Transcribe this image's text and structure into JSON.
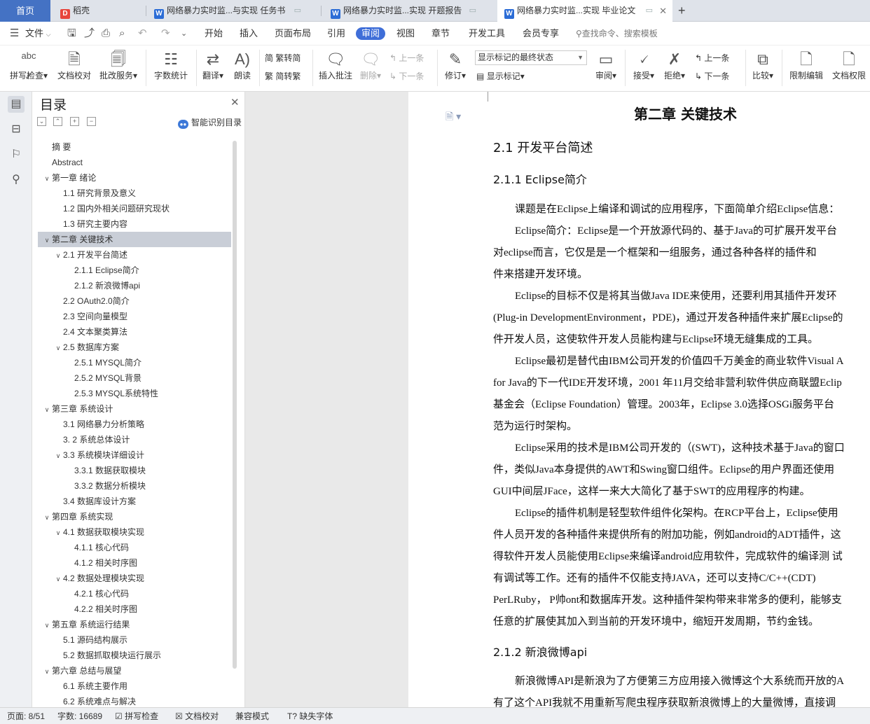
{
  "tabs": {
    "home": "首页",
    "daoke": "稻壳",
    "doc1": "网络暴力实时监...与实现 任务书",
    "doc2": "网络暴力实时监...实现 开题报告",
    "doc3": "网络暴力实时监...实现 毕业论文",
    "new_tab": "+"
  },
  "menu": {
    "file": "文件",
    "items": [
      "开始",
      "插入",
      "页面布局",
      "引用",
      "审阅",
      "视图",
      "章节",
      "开发工具",
      "会员专享"
    ],
    "active_index": 4,
    "search": "查找命令、搜索模板"
  },
  "ribbon": {
    "spellcheck": "拼写检查",
    "doc_proof": "文档校对",
    "batch_review": "批改服务",
    "word_count": "字数统计",
    "translate": "翻译",
    "read_aloud": "朗读",
    "trad_to_simp": "繁转简",
    "simp_to_trad": "简转繁",
    "insert_comment": "插入批注",
    "delete": "删除",
    "prev_comment": "上一条",
    "next_comment": "下一条",
    "revise": "修订",
    "show_markup_state": "显示标记的最终状态",
    "show_markup": "显示标记",
    "review": "审阅",
    "accept": "接受",
    "reject": "拒绝",
    "prev_change": "上一条",
    "next_change": "下一条",
    "compare": "比较",
    "restrict_edit": "限制编辑",
    "doc_permission": "文档权限"
  },
  "toc": {
    "title": "目录",
    "smart_btn": "智能识别目录",
    "items": [
      {
        "text": "摘  要",
        "level": 0,
        "chev": ""
      },
      {
        "text": "Abstract",
        "level": 0,
        "chev": ""
      },
      {
        "text": "第一章 绪论",
        "level": 0,
        "chev": "v"
      },
      {
        "text": "1.1 研究背景及意义",
        "level": 1,
        "chev": ""
      },
      {
        "text": "1.2 国内外相关问题研究现状",
        "level": 1,
        "chev": ""
      },
      {
        "text": "1.3 研究主要内容",
        "level": 1,
        "chev": ""
      },
      {
        "text": "第二章 关键技术",
        "level": 0,
        "chev": "v",
        "active": true
      },
      {
        "text": "2.1 开发平台简述",
        "level": 1,
        "chev": "v"
      },
      {
        "text": "2.1.1 Eclipse简介",
        "level": 2,
        "chev": ""
      },
      {
        "text": "2.1.2 新浪微博api",
        "level": 2,
        "chev": ""
      },
      {
        "text": "2.2 OAuth2.0简介",
        "level": 1,
        "chev": ""
      },
      {
        "text": "2.3 空间向量模型",
        "level": 1,
        "chev": ""
      },
      {
        "text": "2.4 文本聚类算法",
        "level": 1,
        "chev": ""
      },
      {
        "text": "2.5 数据库方案",
        "level": 1,
        "chev": "v"
      },
      {
        "text": "2.5.1 MYSQL简介",
        "level": 2,
        "chev": ""
      },
      {
        "text": "2.5.2 MYSQL背景",
        "level": 2,
        "chev": ""
      },
      {
        "text": "2.5.3 MYSQL系统特性",
        "level": 2,
        "chev": ""
      },
      {
        "text": "第三章 系统设计",
        "level": 0,
        "chev": "v"
      },
      {
        "text": "3.1 网络暴力分析策略",
        "level": 1,
        "chev": ""
      },
      {
        "text": "3. 2 系统总体设计",
        "level": 1,
        "chev": ""
      },
      {
        "text": "3.3 系统模块详细设计",
        "level": 1,
        "chev": "v"
      },
      {
        "text": "3.3.1 数据获取模块",
        "level": 2,
        "chev": ""
      },
      {
        "text": "3.3.2 数据分析模块",
        "level": 2,
        "chev": ""
      },
      {
        "text": "3.4 数据库设计方案",
        "level": 1,
        "chev": ""
      },
      {
        "text": "第四章 系统实现",
        "level": 0,
        "chev": "v"
      },
      {
        "text": "4.1 数据获取模块实现",
        "level": 1,
        "chev": "v"
      },
      {
        "text": "4.1.1 核心代码",
        "level": 2,
        "chev": ""
      },
      {
        "text": "4.1.2 相关时序图",
        "level": 2,
        "chev": ""
      },
      {
        "text": "4.2 数据处理模块实现",
        "level": 1,
        "chev": "v"
      },
      {
        "text": "4.2.1 核心代码",
        "level": 2,
        "chev": ""
      },
      {
        "text": "4.2.2 相关时序图",
        "level": 2,
        "chev": ""
      },
      {
        "text": "第五章 系统运行结果",
        "level": 0,
        "chev": "v"
      },
      {
        "text": "5.1 源码结构展示",
        "level": 1,
        "chev": ""
      },
      {
        "text": "5.2 数据抓取模块运行展示",
        "level": 1,
        "chev": ""
      },
      {
        "text": "第六章 总结与展望",
        "level": 0,
        "chev": "v"
      },
      {
        "text": "6.1 系统主要作用",
        "level": 1,
        "chev": ""
      },
      {
        "text": "6.2 系统难点与解决",
        "level": 1,
        "chev": ""
      }
    ]
  },
  "doc": {
    "chapter": "第二章 关键技术",
    "h_21": "2.1 开发平台简述",
    "h_211": "2.1.1 Eclipse简介",
    "lines": [
      "课题是在Eclipse上编译和调试的应用程序，下面简单介绍Eclipse信息：",
      "Eclipse简介：Eclipse是一个开放源代码的、基于Java的可扩展开发平台",
      "对eclipse而言，它仅是是一个框架和一组服务，通过各种各样的插件和",
      "件来搭建开发环境。",
      "Eclipse的目标不仅是将其当做Java IDE来使用，还要利用其插件开发环",
      "(Plug-in DevelopmentEnvironment，PDE)，通过开发各种插件来扩展Eclipse的",
      "件开发人员，这使软件开发人员能构建与Eclipse环境无缝集成的工具。",
      "Eclipse最初是替代由IBM公司开发的价值四千万美金的商业软件Visual A",
      "for Java的下一代IDE开发环境，2001 年11月交给非营利软件供应商联盟Eclip",
      "基金会（Eclipse Foundation）管理。2003年，Eclipse 3.0选择OSGi服务平台",
      "范为运行时架构。",
      "Eclipse采用的技术是IBM公司开发的（(SWT)，这种技术基于Java的窗口",
      "件，类似Java本身提供的AWT和Swing窗口组件。Eclipse的用户界面还使用",
      "GUI中间层JFace，这样一来大大简化了基于SWT的应用程序的构建。",
      "Eclipse的插件机制是轻型软件组件化架构。在RCP平台上，Eclipse使用",
      "件人员开发的各种插件来提供所有的附加功能，例如android的ADT插件，这",
      "得软件开发人员能使用Eclipse来编译android应用软件，完成软件的编译测 试",
      "有调试等工作。还有的插件不仅能支持JAVA，还可以支持C/C++(CDT)",
      "PerLRuby， P帅ont和数据库开发。这种插件架构带来非常多的便利，能够支",
      "任意的扩展使其加入到当前的开发环境中，缩短开发周期，节约金钱。"
    ],
    "h_212": "2.1.2 新浪微博api",
    "lines2": [
      "新浪微博API是新浪为了方便第三方应用接入微博这个大系统而开放的A",
      "有了这个API我就不用重新写爬虫程序获取新浪微博上的大量微博，直接调"
    ]
  },
  "status": {
    "page": "页面: 8/51",
    "words": "字数: 16689",
    "spell": "拼写检查",
    "proof": "文档校对",
    "compat": "兼容模式",
    "missing_font": "缺失字体"
  },
  "colors": {
    "accent": "#3f6ed8",
    "home_tab": "#4472c4",
    "word_icon": "#2b6cd6"
  }
}
